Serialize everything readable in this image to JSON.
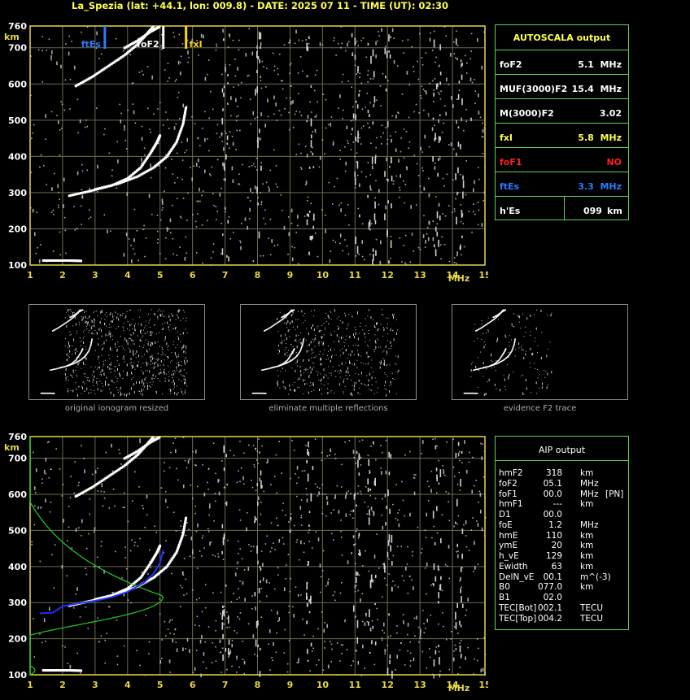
{
  "header": {
    "title": "La_Spezia (lat: +44.1, lon: 009.8) - DATE: 2025 07 11 - TIME (UT): 02:30"
  },
  "colors": {
    "grid": "#6b6b52",
    "axis": "#e6d648",
    "panel_border": "#5fd35f",
    "text_yellow": "#ffff50",
    "fte_blue": "#2a7cff",
    "fo1_red": "#ff2020",
    "profile_green": "#22cc22",
    "trace_blue": "#2030ff"
  },
  "chart_data": [
    {
      "type": "scatter",
      "name": "ionogram-top",
      "xlabel": "MHz",
      "ylabel": "km",
      "xlim": [
        1,
        15
      ],
      "ylim": [
        100,
        760
      ],
      "x_ticks": [
        "1",
        "2",
        "3",
        "4",
        "5",
        "6",
        "7",
        "8",
        "9",
        "10",
        "11",
        "12",
        "13",
        "14",
        "15"
      ],
      "y_ticks": [
        "100",
        "200",
        "300",
        "400",
        "500",
        "600",
        "700",
        "760"
      ],
      "markers": [
        {
          "label": "ftEs",
          "x": 3.3,
          "color": "#2a7cff"
        },
        {
          "label": "foF2",
          "x": 5.1,
          "color": "#ffffff"
        },
        {
          "label": "fxI",
          "x": 5.8,
          "color": "#ffd700"
        }
      ],
      "traces": [
        {
          "name": "F2 O-mode",
          "points": [
            [
              2.2,
              292
            ],
            [
              2.8,
              304
            ],
            [
              3.5,
              320
            ],
            [
              4.0,
              340
            ],
            [
              4.4,
              370
            ],
            [
              4.7,
              410
            ],
            [
              4.9,
              440
            ],
            [
              5.0,
              460
            ]
          ]
        },
        {
          "name": "F2 X-mode",
          "points": [
            [
              3.0,
              310
            ],
            [
              3.7,
              325
            ],
            [
              4.3,
              345
            ],
            [
              4.8,
              370
            ],
            [
              5.2,
              400
            ],
            [
              5.5,
              440
            ],
            [
              5.7,
              490
            ],
            [
              5.8,
              540
            ]
          ]
        },
        {
          "name": "2F2 O-mode",
          "points": [
            [
              2.4,
              595
            ],
            [
              2.9,
              620
            ],
            [
              3.4,
              650
            ],
            [
              3.9,
              680
            ],
            [
              4.3,
              710
            ],
            [
              4.6,
              740
            ],
            [
              4.8,
              760
            ]
          ]
        },
        {
          "name": "2F2 X-mode",
          "points": [
            [
              3.9,
              700
            ],
            [
              4.3,
              720
            ],
            [
              4.7,
              745
            ],
            [
              5.0,
              760
            ]
          ]
        },
        {
          "name": "Es",
          "points": [
            [
              1.4,
              113
            ],
            [
              1.8,
              113
            ],
            [
              2.2,
              113
            ],
            [
              2.6,
              112
            ]
          ]
        }
      ]
    },
    {
      "type": "scatter",
      "name": "ionogram-aip",
      "xlabel": "MHz",
      "ylabel": "km",
      "xlim": [
        1,
        15
      ],
      "ylim": [
        100,
        760
      ],
      "x_ticks": [
        "1",
        "2",
        "3",
        "4",
        "5",
        "6",
        "7",
        "8",
        "9",
        "10",
        "11",
        "12",
        "13",
        "14",
        "15"
      ],
      "y_ticks": [
        "100",
        "200",
        "300",
        "400",
        "500",
        "600",
        "700",
        "760"
      ],
      "profile_peak_km": 318,
      "profile_foF2": 5.1
    }
  ],
  "autoscala": {
    "title": "AUTOSCALA output",
    "rows": [
      {
        "label": "foF2",
        "value": "5.1  MHz",
        "color": "#ffffff"
      },
      {
        "label": "MUF(3000)F2",
        "value": "15.4  MHz",
        "color": "#ffffff"
      },
      {
        "label": "M(3000)F2",
        "value": "3.02",
        "color": "#ffffff"
      },
      {
        "label": "fxI",
        "value": "5.8  MHz",
        "color": "#ffff50"
      },
      {
        "label": "foF1",
        "value": "NO",
        "color": "#ff2020"
      },
      {
        "label": "ftEs",
        "value": "3.3  MHz",
        "color": "#2a7cff"
      },
      {
        "label": "h'Es",
        "value": "099",
        "unit": "km",
        "color": "#ffffff"
      }
    ]
  },
  "aip": {
    "title": "AIP output",
    "rows": [
      {
        "name": "hmF2",
        "value": "318",
        "unit": "km",
        "extra": ""
      },
      {
        "name": "foF2",
        "value": "05.1",
        "unit": "MHz",
        "extra": ""
      },
      {
        "name": "foF1",
        "value": "00.0",
        "unit": "MHz",
        "extra": "[PN]"
      },
      {
        "name": "hmF1",
        "value": "---",
        "unit": "km",
        "extra": ""
      },
      {
        "name": "D1",
        "value": "00.0",
        "unit": "",
        "extra": ""
      },
      {
        "name": "foE",
        "value": "1.2",
        "unit": "MHz",
        "extra": ""
      },
      {
        "name": "hmE",
        "value": "110",
        "unit": "km",
        "extra": ""
      },
      {
        "name": "ymE",
        "value": "20",
        "unit": "km",
        "extra": ""
      },
      {
        "name": "h_vE",
        "value": "129",
        "unit": "km",
        "extra": ""
      },
      {
        "name": "Ewidth",
        "value": "63",
        "unit": "km",
        "extra": ""
      },
      {
        "name": "DelN_vE",
        "value": "00.1",
        "unit": "m^(-3)",
        "extra": ""
      },
      {
        "name": "B0",
        "value": "077.0",
        "unit": "km",
        "extra": ""
      },
      {
        "name": "B1",
        "value": "02.0",
        "unit": "",
        "extra": ""
      },
      {
        "name": "TEC[Bot]",
        "value": "002.1",
        "unit": "TECU",
        "extra": ""
      },
      {
        "name": "TEC[Top]",
        "value": "004.2",
        "unit": "TECU",
        "extra": ""
      }
    ]
  },
  "thumbnails": [
    {
      "caption": "original ionogram resized"
    },
    {
      "caption": "eliminate multiple reflections"
    },
    {
      "caption": "evidence F2 trace"
    }
  ]
}
